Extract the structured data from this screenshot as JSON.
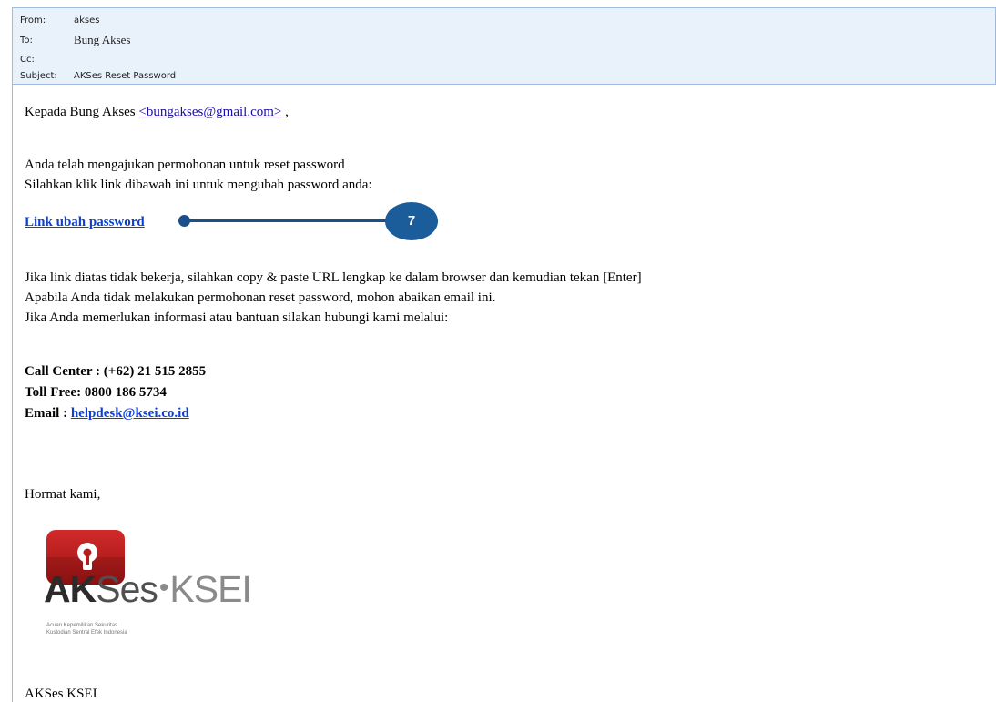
{
  "header": {
    "from_label": "From:",
    "from_value": "akses",
    "to_label": "To:",
    "to_value": "Bung Akses",
    "cc_label": "Cc:",
    "cc_value": "",
    "subject_label": "Subject:",
    "subject_value": "AKSes Reset Password"
  },
  "body": {
    "greeting_prefix": "Kepada Bung Akses",
    "greeting_email": "<bungakses@gmail.com>",
    "greeting_suffix": " ,",
    "line1": "Anda telah mengajukan permohonan untuk reset password",
    "line2": "Silahkan klik link dibawah ini untuk mengubah password anda:",
    "link_text": "Link ubah password",
    "line3": "Jika link diatas tidak bekerja, silahkan copy & paste URL lengkap ke dalam browser dan kemudian tekan [Enter]",
    "line4": "Apabila Anda tidak melakukan permohonan reset password, mohon abaikan email ini.",
    "line5": "Jika Anda memerlukan informasi atau bantuan silakan hubungi kami melalui:",
    "call_center": "Call Center : (+62) 21 515 2855",
    "toll_free": "Toll Free: 0800 186 5734",
    "email_label": "Email : ",
    "email_value": "helpdesk@ksei.co.id",
    "closing": "Hormat kami,",
    "signature": "AKSes KSEI"
  },
  "callout": {
    "number": "7",
    "color": "#1b5c9a"
  },
  "logo": {
    "word_ak": "AK",
    "word_ses": "Ses",
    "separator": "•",
    "word_ksei": "KSEI",
    "tagline1": "Acuan Kepemilikan Sekuritas",
    "tagline2": "Kustodian Sentral Efek Indonesia",
    "brand_color": "#c21f1f"
  }
}
